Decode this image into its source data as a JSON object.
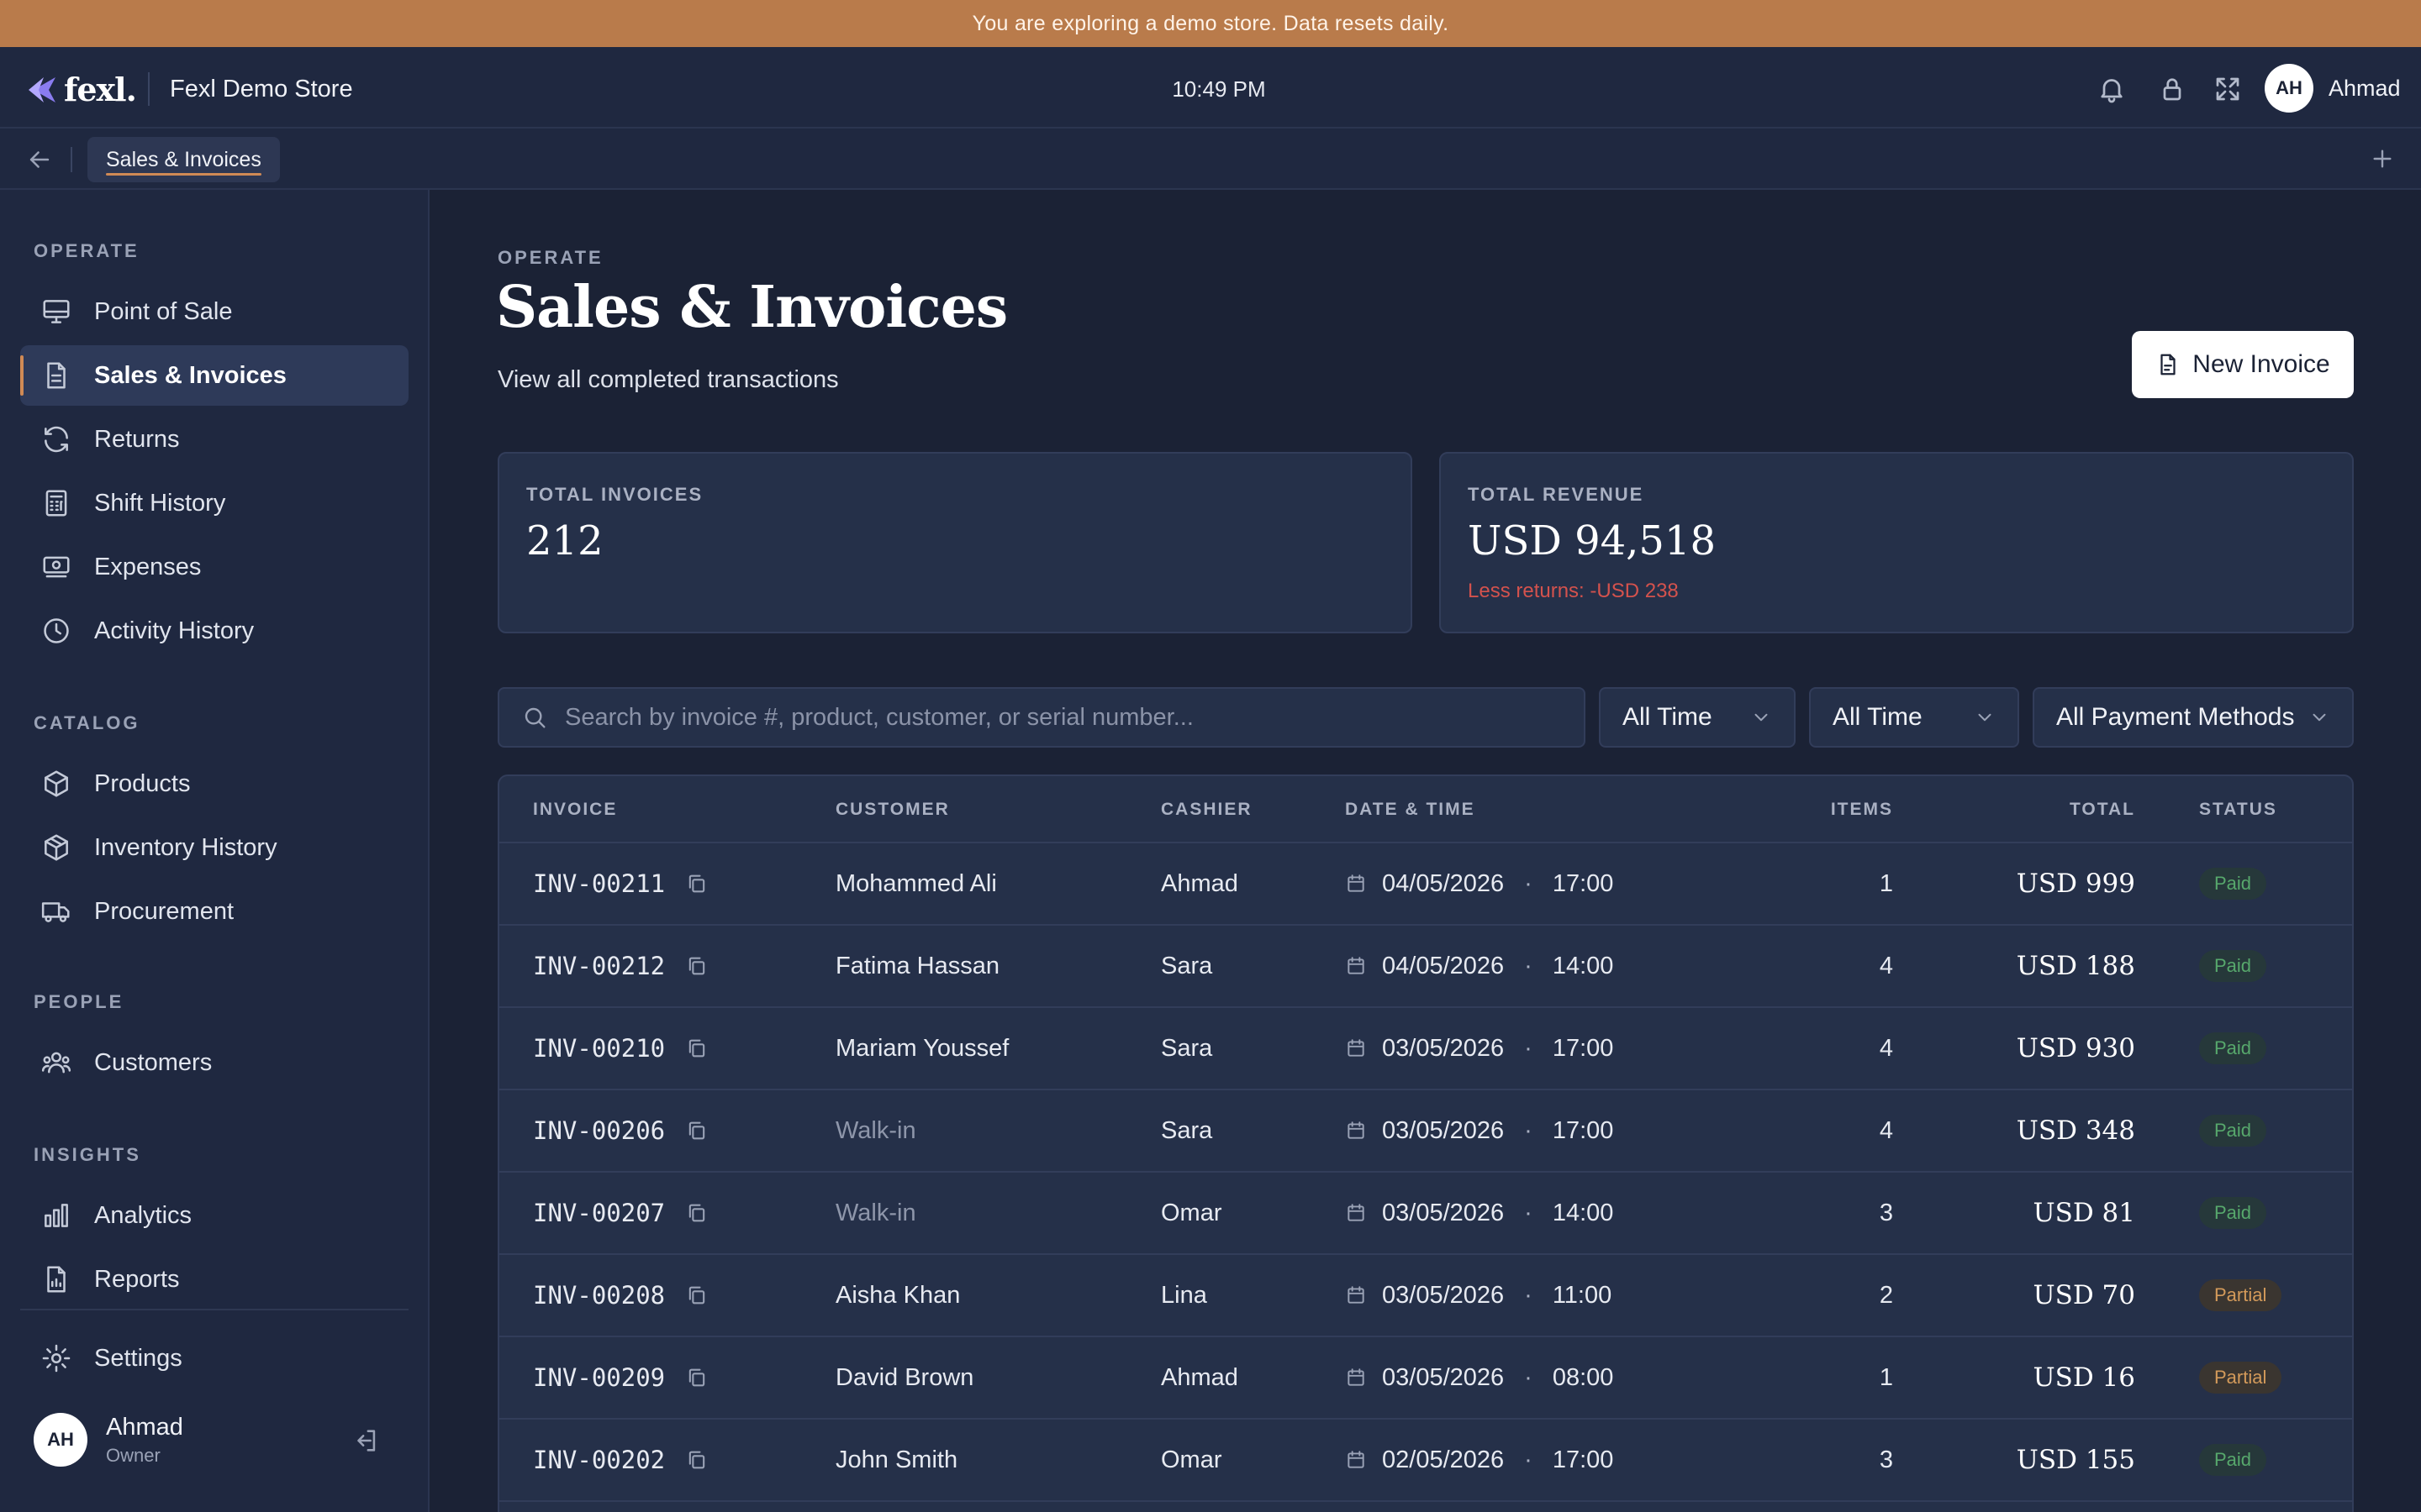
{
  "banner": {
    "text": "You are exploring a demo store. Data resets daily."
  },
  "topbar": {
    "logo_text": "fexl.",
    "store_name": "Fexl Demo Store",
    "time": "10:49 PM",
    "user_initials": "AH",
    "user_name": "Ahmad",
    "icons": [
      "bell-icon",
      "lock-icon",
      "expand-icon"
    ]
  },
  "tabs": {
    "active_label": "Sales & Invoices"
  },
  "sidebar": {
    "sections": {
      "operate": "OPERATE",
      "catalog": "CATALOG",
      "people": "PEOPLE",
      "insights": "INSIGHTS"
    },
    "items": {
      "pos": "Point of Sale",
      "sales": "Sales & Invoices",
      "returns": "Returns",
      "shifts": "Shift History",
      "expenses": "Expenses",
      "activity": "Activity History",
      "products": "Products",
      "inventory": "Inventory History",
      "procurement": "Procurement",
      "customers": "Customers",
      "analytics": "Analytics",
      "reports": "Reports",
      "settings": "Settings"
    },
    "user": {
      "initials": "AH",
      "name": "Ahmad",
      "role": "Owner"
    }
  },
  "page": {
    "breadcrumb": "OPERATE",
    "title": "Sales & Invoices",
    "subtitle": "View all completed transactions",
    "new_invoice_label": "New Invoice"
  },
  "stats": {
    "invoices_label": "TOTAL INVOICES",
    "invoices_value": "212",
    "revenue_label": "TOTAL REVENUE",
    "revenue_value": "USD 94,518",
    "revenue_note": "Less returns: -USD 238"
  },
  "filters": {
    "search_placeholder": "Search by invoice #, product, customer, or serial number...",
    "range_1": "All Time",
    "range_2": "All Time",
    "payment": "All Payment Methods"
  },
  "table": {
    "headers": {
      "invoice": "INVOICE",
      "customer": "CUSTOMER",
      "cashier": "CASHIER",
      "datetime": "DATE & TIME",
      "items": "ITEMS",
      "total": "TOTAL",
      "status": "STATUS"
    },
    "rows": [
      {
        "invoice": "INV-00211",
        "customer": "Mohammed Ali",
        "cashier": "Ahmad",
        "date": "04/05/2026",
        "time": "17:00",
        "items": "1",
        "total": "USD 999",
        "status": "Paid"
      },
      {
        "invoice": "INV-00212",
        "customer": "Fatima Hassan",
        "cashier": "Sara",
        "date": "04/05/2026",
        "time": "14:00",
        "items": "4",
        "total": "USD 188",
        "status": "Paid"
      },
      {
        "invoice": "INV-00210",
        "customer": "Mariam Youssef",
        "cashier": "Sara",
        "date": "03/05/2026",
        "time": "17:00",
        "items": "4",
        "total": "USD 930",
        "status": "Paid"
      },
      {
        "invoice": "INV-00206",
        "customer": "Walk-in",
        "cashier": "Sara",
        "date": "03/05/2026",
        "time": "17:00",
        "items": "4",
        "total": "USD 348",
        "status": "Paid"
      },
      {
        "invoice": "INV-00207",
        "customer": "Walk-in",
        "cashier": "Omar",
        "date": "03/05/2026",
        "time": "14:00",
        "items": "3",
        "total": "USD 81",
        "status": "Paid"
      },
      {
        "invoice": "INV-00208",
        "customer": "Aisha Khan",
        "cashier": "Lina",
        "date": "03/05/2026",
        "time": "11:00",
        "items": "2",
        "total": "USD 70",
        "status": "Partial"
      },
      {
        "invoice": "INV-00209",
        "customer": "David Brown",
        "cashier": "Ahmad",
        "date": "03/05/2026",
        "time": "08:00",
        "items": "1",
        "total": "USD 16",
        "status": "Partial"
      },
      {
        "invoice": "INV-00202",
        "customer": "John Smith",
        "cashier": "Omar",
        "date": "02/05/2026",
        "time": "17:00",
        "items": "3",
        "total": "USD 155",
        "status": "Paid"
      }
    ]
  },
  "colors": {
    "accent": "#d08a55",
    "banner": "#b97b4b",
    "background": "#1b2235",
    "paid": "#57a86c",
    "partial": "#d39a5a",
    "negative": "#d4524d"
  }
}
